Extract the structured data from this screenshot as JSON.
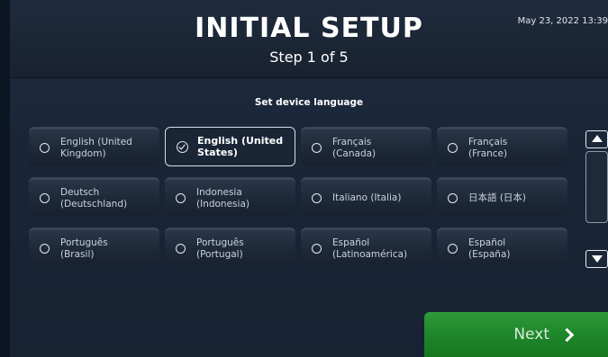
{
  "header": {
    "title": "INITIAL SETUP",
    "step": "Step 1 of 5",
    "datetime": "May 23, 2022 13:39"
  },
  "language_section": {
    "label": "Set device language",
    "selected_index": 1,
    "options": [
      {
        "label": "English (United\nKingdom)"
      },
      {
        "label": "English (United\nStates)"
      },
      {
        "label": "Français\n(Canada)"
      },
      {
        "label": "Français\n(France)"
      },
      {
        "label": "Deutsch\n(Deutschland)"
      },
      {
        "label": "Indonesia\n(Indonesia)"
      },
      {
        "label": "Italiano (Italia)"
      },
      {
        "label": "日本語 (日本)"
      },
      {
        "label": "Português\n(Brasil)"
      },
      {
        "label": "Português\n(Portugal)"
      },
      {
        "label": "Español\n(Latinoamérica)"
      },
      {
        "label": "Español\n(España)"
      }
    ]
  },
  "footer": {
    "next_label": "Next"
  }
}
